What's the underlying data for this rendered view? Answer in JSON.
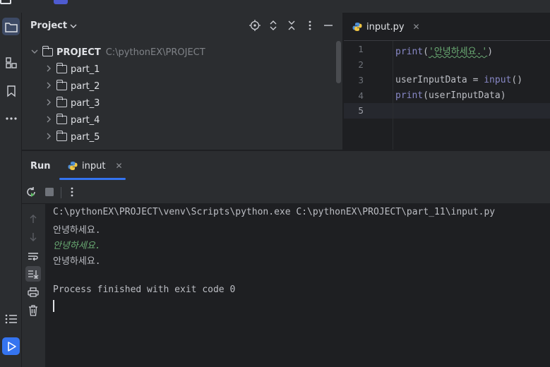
{
  "project_panel": {
    "title": "Project",
    "root": {
      "name": "PROJECT",
      "path": "C:\\pythonEX\\PROJECT"
    },
    "folders": [
      "part_1",
      "part_2",
      "part_3",
      "part_4",
      "part_5"
    ]
  },
  "editor": {
    "tab_label": "input.py",
    "line_numbers": [
      "1",
      "2",
      "3",
      "4",
      "5"
    ],
    "lines": {
      "l1_fn": "print",
      "l1_open": "(",
      "l1_str": "'안녕하세요.'",
      "l1_close": ")",
      "l3_var": "userInputData = ",
      "l3_fn": "input",
      "l3_paren": "()",
      "l4_fn": "print",
      "l4_arg": "(userInputData)"
    }
  },
  "run_panel": {
    "title": "Run",
    "tab_label": "input",
    "console": {
      "command": "C:\\pythonEX\\PROJECT\\venv\\Scripts\\python.exe C:\\pythonEX\\PROJECT\\part_11\\input.py",
      "output_1": "안녕하세요.",
      "user_input": "안녕하세요.",
      "output_2": "안녕하세요.",
      "exit_message": "Process finished with exit code 0"
    }
  },
  "colors": {
    "accent": "#3574f0",
    "string": "#6aab73",
    "builtin": "#8888c6"
  }
}
